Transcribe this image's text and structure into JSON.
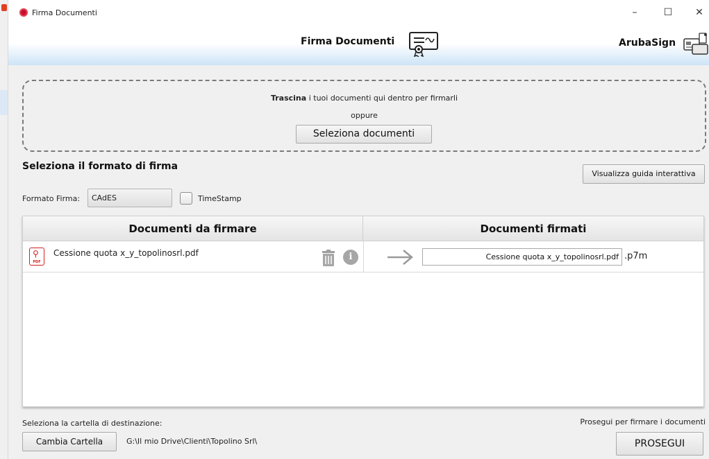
{
  "window": {
    "title": "Firma Documenti",
    "minimize": "–",
    "maximize": "☐",
    "close": "✕"
  },
  "header": {
    "title": "Firma Documenti",
    "brand": "ArubaSign"
  },
  "dropzone": {
    "bold": "Trascina",
    "text": " i tuoi documenti qui dentro per firmarli",
    "or": "oppure",
    "button": "Seleziona documenti"
  },
  "format": {
    "section_title": "Seleziona il formato di firma",
    "guide_button": "Visualizza guida interattiva",
    "label": "Formato Firma:",
    "selected": "CAdES",
    "timestamp_label": "TimeStamp",
    "timestamp_checked": false
  },
  "table": {
    "col_to_sign": "Documenti da firmare",
    "col_signed": "Documenti firmati",
    "rows": [
      {
        "name": "Cessione quota x_y_topolinosrl.pdf",
        "output": "Cessione quota x_y_topolinosrl.pdf",
        "extension": ".p7m"
      }
    ]
  },
  "footer": {
    "dest_label": "Seleziona la cartella di destinazione:",
    "change_button": "Cambia Cartella",
    "dest_path": "G:\\Il mio Drive\\Clienti\\Topolino Srl\\",
    "proceed_label": "Prosegui per firmare i documenti",
    "proceed_button": "PROSEGUI"
  },
  "icons": {
    "app": "aruba-logo-icon",
    "header": "certificate-icon",
    "brand": "smartcard-reader-icon",
    "file": "pdf-file-icon",
    "delete": "trash-icon",
    "info": "info-icon",
    "arrow": "arrow-right-icon"
  },
  "colors": {
    "header_gradient_end": "#cde4f7",
    "pdf_red": "#d42020",
    "app_icon": "#c8102e"
  }
}
